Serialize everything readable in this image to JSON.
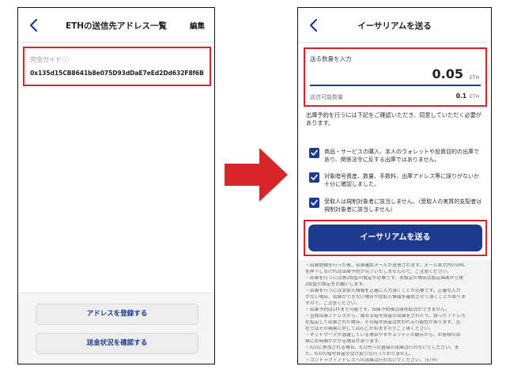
{
  "left_screen": {
    "title": "ETHの送信先アドレス一覧",
    "edit_label": "編集",
    "address_label": "完全ガイド",
    "address_info_icon": "info-icon",
    "address_value": "0x135d15CB8641b8e075D93dDaE7eEd2Dd632F8f6B",
    "register_button": "アドレスを登録する",
    "check_status_button": "送金状況を確認する"
  },
  "right_screen": {
    "title": "イーサリアムを送る",
    "amount_label": "送る数量を入力",
    "amount_value": "0.05",
    "amount_unit": "ETH",
    "available_label": "送信可能数量",
    "available_value": "0.1",
    "available_unit": "ETH",
    "notice": "出庫予約を行うには下記をご確認いただき、同意していただく必要があります。",
    "checks": [
      "商品・サービスの購入、本人のウォレットや投資目的の出庫であり、関係法令に反する出庫ではありません。",
      "対象暗号資産、数量、手数料、出庫アドレス等に誤りがないか十分に確認しました。",
      "受取人は規制対象者に該当しません。（受取人の実質的支配者は規制対象者に該当しません）"
    ],
    "send_button": "イーサリアムを送る",
    "notes": [
      "・出庫依頼を行った後、出庫確認メールが送信されます。メール本文内のURL",
      "を押下しなければ出庫予約が完了いたしませんので、ご注意ください。",
      "・出庫を行うには第2認証の設定が必要です。未設定の場合は設定画面から第",
      "2認証の設定をお願いします。",
      "・出庫を行うには受取人情報を正確に入力頂くことが必要です。正確な入力",
      "がない場合、出庫ができない場合や受取人情報を確認させて頂くことがありま",
      "すので、ご注意ください。",
      "・出庫予約は1件まで可能です。出庫予約後は原則取消ができません。",
      "・当該出庫アドレスから、異なる暗号資産の出庫をされたり、誤ったアドレス",
      "を指定して出庫された場合、その暗号資産は失われる可能性があります。当",
      "社ではその損害に対しては応じかねますのでご了承ください。",
      "・ネットワークが混雑している場合やセキュリティの観点から、お客様の出",
      "庫にお時間がかかる場合があります。",
      "・ICOに参加される場合、ICO先への直接の出庫は行わないでください。ま",
      "た、ICOの暗号資産の受け取りも行っておりません。",
      "・コントラクトアドレスへの出庫は行わないでください。（ETH）"
    ]
  },
  "colors": {
    "accent": "#1d3a8f",
    "highlight_border": "#d7262a",
    "arrow": "#d7262a"
  }
}
